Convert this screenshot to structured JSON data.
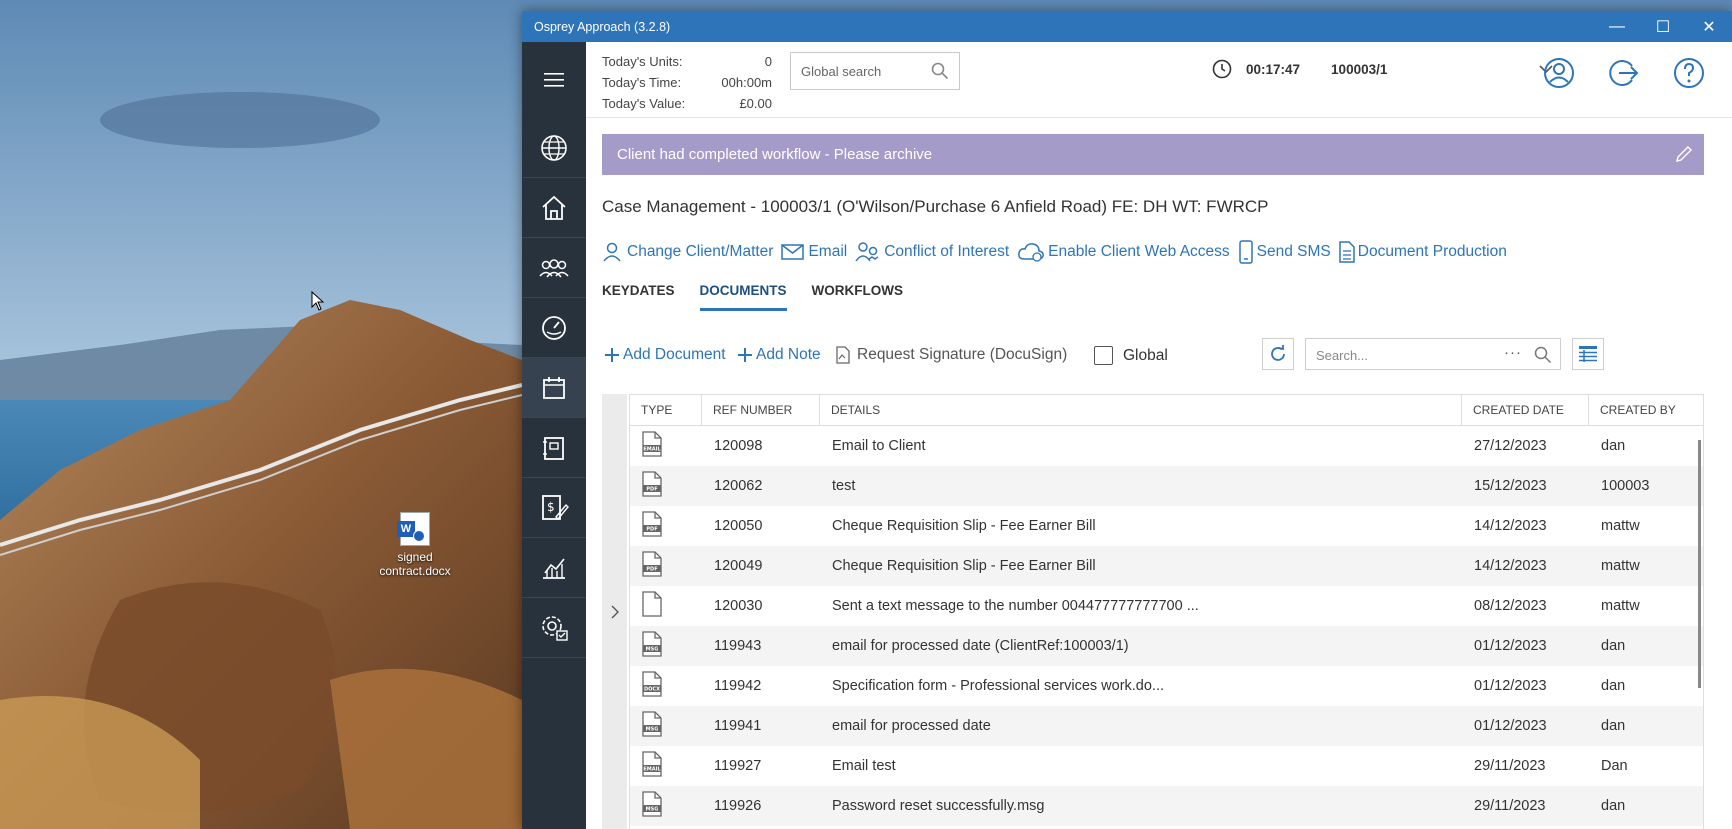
{
  "desktop": {
    "icon_label": "signed contract.docx"
  },
  "window": {
    "title": "Osprey Approach (3.2.8)",
    "minimize": "—",
    "maximize": "☐",
    "close": "✕"
  },
  "sidebar": {
    "items": [
      "menu-icon",
      "globe-icon",
      "home-icon",
      "users-icon",
      "dashboard-icon",
      "calendar-icon",
      "ledger-icon",
      "billing-icon",
      "reports-icon",
      "settings-icon"
    ]
  },
  "stats": {
    "units_label": "Today's Units:",
    "units_value": "0",
    "time_label": "Today's Time:",
    "time_value": "00h:00m",
    "value_label": "Today's Value:",
    "value_value": "£0.00"
  },
  "global_search": {
    "placeholder": "Global search"
  },
  "timer": {
    "elapsed": "00:17:47",
    "matter": "100003/1"
  },
  "banner": {
    "text": "Client had completed workflow - Please archive"
  },
  "case": {
    "title": "Case Management - 100003/1 (O'Wilson/Purchase 6 Anfield Road) FE: DH WT: FWRCP"
  },
  "actions": {
    "change_client": "Change Client/Matter",
    "email": "Email",
    "conflict": "Conflict of Interest",
    "web_access": "Enable Client Web Access",
    "sms": "Send SMS",
    "doc_production": "Document Production"
  },
  "tabs": [
    "KEYDATES",
    "DOCUMENTS",
    "WORKFLOWS"
  ],
  "toolbar": {
    "add_document": "Add Document",
    "add_note": "Add Note",
    "request_signature": "Request Signature (DocuSign)",
    "global": "Global",
    "search_placeholder": "Search...",
    "dots": "···"
  },
  "grid": {
    "headers": [
      "TYPE",
      "REF NUMBER",
      "DETAILS",
      "CREATED DATE",
      "CREATED BY"
    ],
    "rows": [
      {
        "type": "EMAIL",
        "ref": "120098",
        "details": "Email to Client",
        "date": "27/12/2023",
        "by": "dan"
      },
      {
        "type": "PDF",
        "ref": "120062",
        "details": "test",
        "date": "15/12/2023",
        "by": "100003"
      },
      {
        "type": "PDF",
        "ref": "120050",
        "details": "Cheque Requisition Slip - Fee Earner Bill",
        "date": "14/12/2023",
        "by": "mattw"
      },
      {
        "type": "PDF",
        "ref": "120049",
        "details": "Cheque Requisition Slip - Fee Earner Bill",
        "date": "14/12/2023",
        "by": "mattw"
      },
      {
        "type": "",
        "ref": "120030",
        "details": "Sent a text message to the number 004477777777700 ...",
        "date": "08/12/2023",
        "by": "mattw"
      },
      {
        "type": "MSG",
        "ref": "119943",
        "details": "email for processed date (ClientRef:100003/1)",
        "date": "01/12/2023",
        "by": "dan"
      },
      {
        "type": "DOCX",
        "ref": "119942",
        "details": "Specification form - Professional services work.do...",
        "date": "01/12/2023",
        "by": "dan"
      },
      {
        "type": "MSG",
        "ref": "119941",
        "details": "email for processed date",
        "date": "01/12/2023",
        "by": "dan"
      },
      {
        "type": "EMAIL",
        "ref": "119927",
        "details": "Email test",
        "date": "29/11/2023",
        "by": "Dan"
      },
      {
        "type": "MSG",
        "ref": "119926",
        "details": "Password reset successfully.msg",
        "date": "29/11/2023",
        "by": "dan"
      }
    ]
  },
  "colors": {
    "accent": "#2d75b8",
    "sidebar": "#28323d",
    "banner": "#a59bc9"
  }
}
